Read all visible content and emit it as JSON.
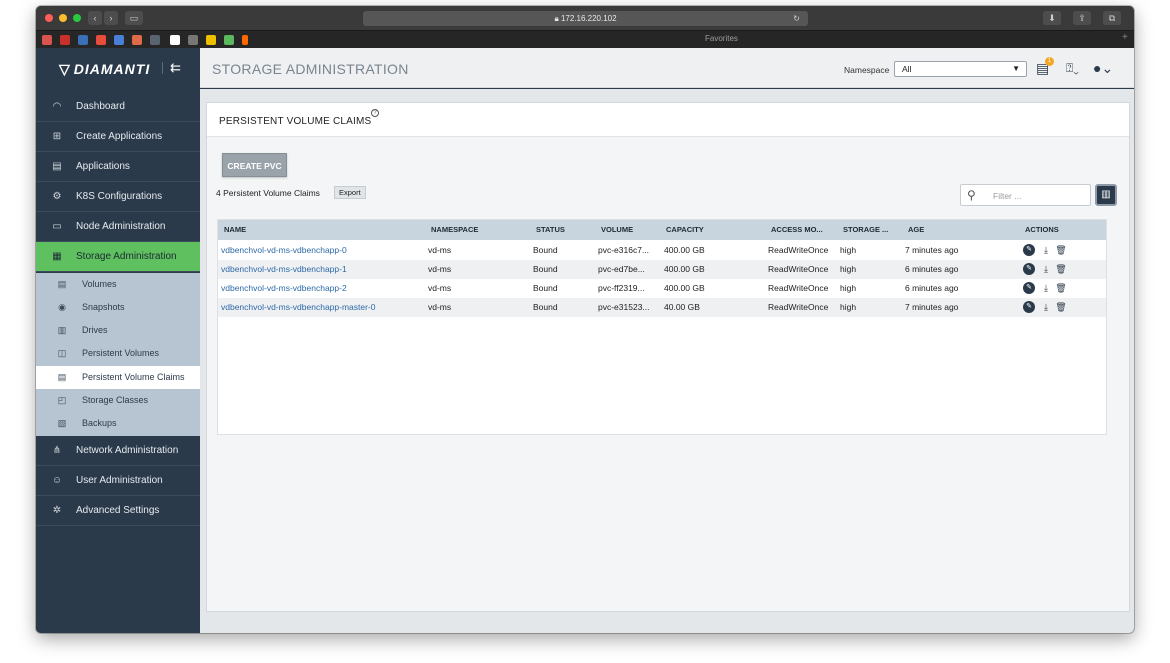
{
  "browser": {
    "url": "172.16.220.102",
    "favorites_label": "Favorites",
    "bookmark_colors": [
      "#d9534f",
      "#c9302c",
      "#3b6fb6",
      "#e74c3c",
      "#4a7fd6",
      "#e06b4a",
      "#5a6470",
      "#ffffff",
      "#777777",
      "#f0c000",
      "#5cb85c",
      "#ff6a00"
    ]
  },
  "app": {
    "logo_text": "DIAMANTI",
    "page_title": "STORAGE ADMINISTRATION",
    "namespace_label": "Namespace",
    "namespace_value": "All",
    "notification_count": "1"
  },
  "sidebar": {
    "items": [
      {
        "label": "Dashboard",
        "icon": "dashboard-icon",
        "glyph": "◠"
      },
      {
        "label": "Create Applications",
        "icon": "plus-square-icon",
        "glyph": "⊞"
      },
      {
        "label": "Applications",
        "icon": "list-icon",
        "glyph": "▤"
      },
      {
        "label": "K8S Configurations",
        "icon": "gears-icon",
        "glyph": "⚙"
      },
      {
        "label": "Node Administration",
        "icon": "server-icon",
        "glyph": "▭"
      },
      {
        "label": "Storage Administration",
        "icon": "database-icon",
        "glyph": "▦"
      },
      {
        "label": "Network Administration",
        "icon": "network-icon",
        "glyph": "⋔"
      },
      {
        "label": "User Administration",
        "icon": "users-icon",
        "glyph": "☺"
      },
      {
        "label": "Advanced Settings",
        "icon": "settings-icon",
        "glyph": "✲"
      }
    ],
    "sub_items": [
      {
        "label": "Volumes",
        "icon": "volumes-icon",
        "glyph": "▤"
      },
      {
        "label": "Snapshots",
        "icon": "snapshots-icon",
        "glyph": "◉"
      },
      {
        "label": "Drives",
        "icon": "drives-icon",
        "glyph": "▥"
      },
      {
        "label": "Persistent Volumes",
        "icon": "persistent-volumes-icon",
        "glyph": "◫"
      },
      {
        "label": "Persistent Volume Claims",
        "icon": "pvc-icon",
        "glyph": "▤"
      },
      {
        "label": "Storage Classes",
        "icon": "storage-classes-icon",
        "glyph": "◰"
      },
      {
        "label": "Backups",
        "icon": "backups-icon",
        "glyph": "▧"
      }
    ]
  },
  "panel": {
    "title": "PERSISTENT VOLUME CLAIMS",
    "create_button": "CREATE PVC",
    "count_text": "4 Persistent Volume Claims",
    "export_label": "Export",
    "filter_placeholder": "Filter ..."
  },
  "table": {
    "headers": [
      "NAME",
      "NAMESPACE",
      "STATUS",
      "VOLUME",
      "CAPACITY",
      "ACCESS MO...",
      "STORAGE ...",
      "AGE",
      "ACTIONS"
    ],
    "rows": [
      {
        "name": "vdbenchvol-vd-ms-vdbenchapp-0",
        "namespace": "vd-ms",
        "status": "Bound",
        "volume": "pvc-e316c7...",
        "capacity": "400.00 GB",
        "access_mode": "ReadWriteOnce",
        "storage_class": "high",
        "age": "7 minutes ago"
      },
      {
        "name": "vdbenchvol-vd-ms-vdbenchapp-1",
        "namespace": "vd-ms",
        "status": "Bound",
        "volume": "pvc-ed7be...",
        "capacity": "400.00 GB",
        "access_mode": "ReadWriteOnce",
        "storage_class": "high",
        "age": "6 minutes ago"
      },
      {
        "name": "vdbenchvol-vd-ms-vdbenchapp-2",
        "namespace": "vd-ms",
        "status": "Bound",
        "volume": "pvc-ff2319...",
        "capacity": "400.00 GB",
        "access_mode": "ReadWriteOnce",
        "storage_class": "high",
        "age": "6 minutes ago"
      },
      {
        "name": "vdbenchvol-vd-ms-vdbenchapp-master-0",
        "namespace": "vd-ms",
        "status": "Bound",
        "volume": "pvc-e31523...",
        "capacity": "40.00 GB",
        "access_mode": "ReadWriteOnce",
        "storage_class": "high",
        "age": "7 minutes ago"
      }
    ]
  },
  "colors": {
    "sidebar_bg": "#2b3a4a",
    "active_green": "#5fc05f",
    "submenu_bg": "#b7c5d2",
    "link_blue": "#2d6aa8",
    "table_header_bg": "#c8d4de"
  }
}
